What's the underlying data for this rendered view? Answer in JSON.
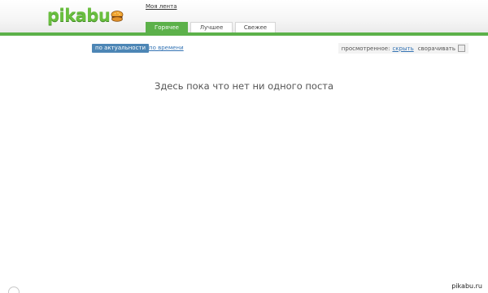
{
  "logo": {
    "text": "pikabu"
  },
  "header": {
    "my_feed": "Моя лента",
    "tabs": [
      {
        "label": "Горячее",
        "active": true
      },
      {
        "label": "Лучшее",
        "active": false
      },
      {
        "label": "Свежее",
        "active": false
      }
    ]
  },
  "sort": {
    "active_label": "по актуальности",
    "other_label": "по времени"
  },
  "viewed": {
    "label": "просмотренное:",
    "hide_link": "скрыть",
    "collapse_label": "сворачивать"
  },
  "main": {
    "empty_message": "Здесь пока что нет ни одного поста"
  },
  "watermark": "pikabu.ru",
  "colors": {
    "accent_green": "#5cb14a",
    "link_blue": "#3574b4",
    "active_sort_bg": "#4d86b5"
  }
}
